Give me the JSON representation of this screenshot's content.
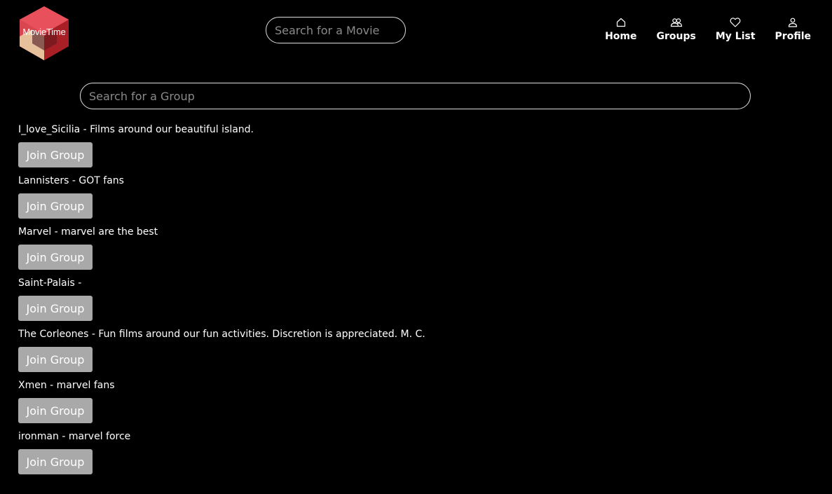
{
  "header": {
    "logo_text": "MovieTime",
    "movie_search": {
      "placeholder": "Search for a Movie",
      "value": ""
    },
    "nav": [
      {
        "label": "Home",
        "icon": "home-icon"
      },
      {
        "label": "Groups",
        "icon": "groups-icon"
      },
      {
        "label": "My List",
        "icon": "heart-icon"
      },
      {
        "label": "Profile",
        "icon": "user-icon"
      }
    ]
  },
  "group_search": {
    "placeholder": "Search for a Group",
    "value": ""
  },
  "groups": [
    {
      "description": "I_love_Sicilia - Films around our beautiful island.",
      "button": "Join Group"
    },
    {
      "description": "Lannisters - GOT fans",
      "button": "Join Group"
    },
    {
      "description": "Marvel - marvel are the best",
      "button": "Join Group"
    },
    {
      "description": "Saint-Palais - ",
      "button": "Join Group"
    },
    {
      "description": "The Corleones - Fun films around our fun activities. Discretion is appreciated. M. C.",
      "button": "Join Group"
    },
    {
      "description": "Xmen - marvel fans",
      "button": "Join Group"
    },
    {
      "description": "ironman - marvel force",
      "button": "Join Group"
    }
  ],
  "colors": {
    "background": "#000000",
    "button": "#a9a9a9",
    "logo_red": "#e8505b",
    "logo_dark_red": "#a81f26",
    "logo_beige": "#e6c19c"
  }
}
